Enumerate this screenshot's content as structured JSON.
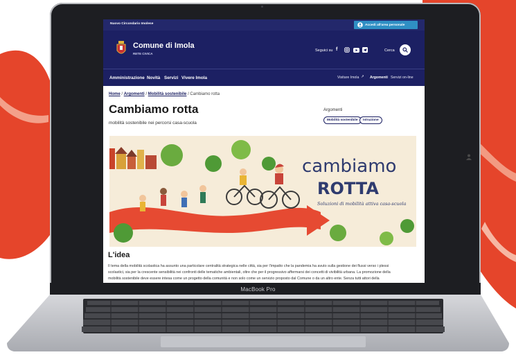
{
  "background": {
    "shape_color": "#e5452b",
    "bg_color": "#ffffff"
  },
  "device": {
    "name": "MacBook Pro"
  },
  "website": {
    "topbar": {
      "region_label": "Nuovo Circondario Imolese",
      "login_label": "Accedi all'area personale"
    },
    "header": {
      "org_name": "Comune di Imola",
      "org_tag": "RETE CIVICA",
      "follow_label": "Seguici su",
      "search_label": "Cerca"
    },
    "nav": {
      "items": [
        "Amministrazione",
        "Novità",
        "Servizi",
        "Vivere Imola"
      ],
      "right_items": [
        "Visitare Imola",
        "Argomenti",
        "Servizi on-line"
      ]
    },
    "breadcrumb": {
      "items": [
        "Home",
        "Argomenti",
        "Mobilità sostenibile",
        "Cambiamo rotta"
      ],
      "separator": "/"
    },
    "page": {
      "title": "Cambiamo rotta",
      "subtitle": "mobilità sostenibile nei percorsi casa-scuola"
    },
    "topics": {
      "heading": "Argomenti",
      "chips": [
        "Mobilità sostenibile",
        "Istruzione"
      ]
    },
    "banner": {
      "title_line1": "cambiamo",
      "title_line2": "ROTTA",
      "tagline": "Soluzioni di mobilità attiva casa-scuola"
    },
    "section": {
      "heading": "L'idea",
      "paragraph_lines": [
        "Il tema della mobilità scolastica ha assunto una particolare centralità strategica nelle città, sia per l'impatto che la pandemia ha avuto sulla gestione dei flussi verso i plessi",
        "scolastici, sia per la crescente sensibilità nei confronti delle tematiche ambientali, oltre che per il progressivo affermarsi dei concetti di vivibilità urbana. La promozione della",
        "mobilità sostenibile deve essere intesa come un progetto della comunità e non solo come un servizio proposto dal Comune o da un altro ente. Senza tutti attori della"
      ]
    },
    "colors": {
      "navy": "#1c2063",
      "login_blue": "#2f8fc4",
      "accent_orange": "#e25b2c"
    }
  }
}
